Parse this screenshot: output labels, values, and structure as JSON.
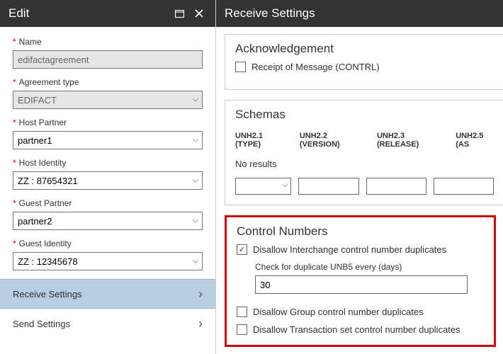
{
  "left": {
    "header_title": "Edit",
    "fields": {
      "name": {
        "label": "Name",
        "value": "edifactagreement"
      },
      "agreement_type": {
        "label": "Agreement type",
        "value": "EDIFACT"
      },
      "host_partner": {
        "label": "Host Partner",
        "value": "partner1"
      },
      "host_identity": {
        "label": "Host Identity",
        "value": "ZZ : 87654321"
      },
      "guest_partner": {
        "label": "Guest Partner",
        "value": "partner2"
      },
      "guest_identity": {
        "label": "Guest Identity",
        "value": "ZZ : 12345678"
      }
    },
    "nav": {
      "receive": "Receive Settings",
      "send": "Send Settings"
    }
  },
  "right": {
    "header_title": "Receive Settings",
    "ack": {
      "title": "Acknowledgement",
      "receipt_label": "Receipt of Message (CONTRL)"
    },
    "schemas": {
      "title": "Schemas",
      "headers": {
        "h1": "UNH2.1 (TYPE)",
        "h2": "UNH2.2 (VERSION)",
        "h3": "UNH2.3 (RELEASE)",
        "h4": "UNH2.5 (AS"
      },
      "no_results": "No results"
    },
    "control": {
      "title": "Control Numbers",
      "disallow_interchange": "Disallow Interchange control number duplicates",
      "check_dup_label": "Check for duplicate UNB5 every (days)",
      "check_dup_value": "30",
      "disallow_group": "Disallow Group control number duplicates",
      "disallow_txn": "Disallow Transaction set control number duplicates"
    }
  },
  "chart_data": null
}
